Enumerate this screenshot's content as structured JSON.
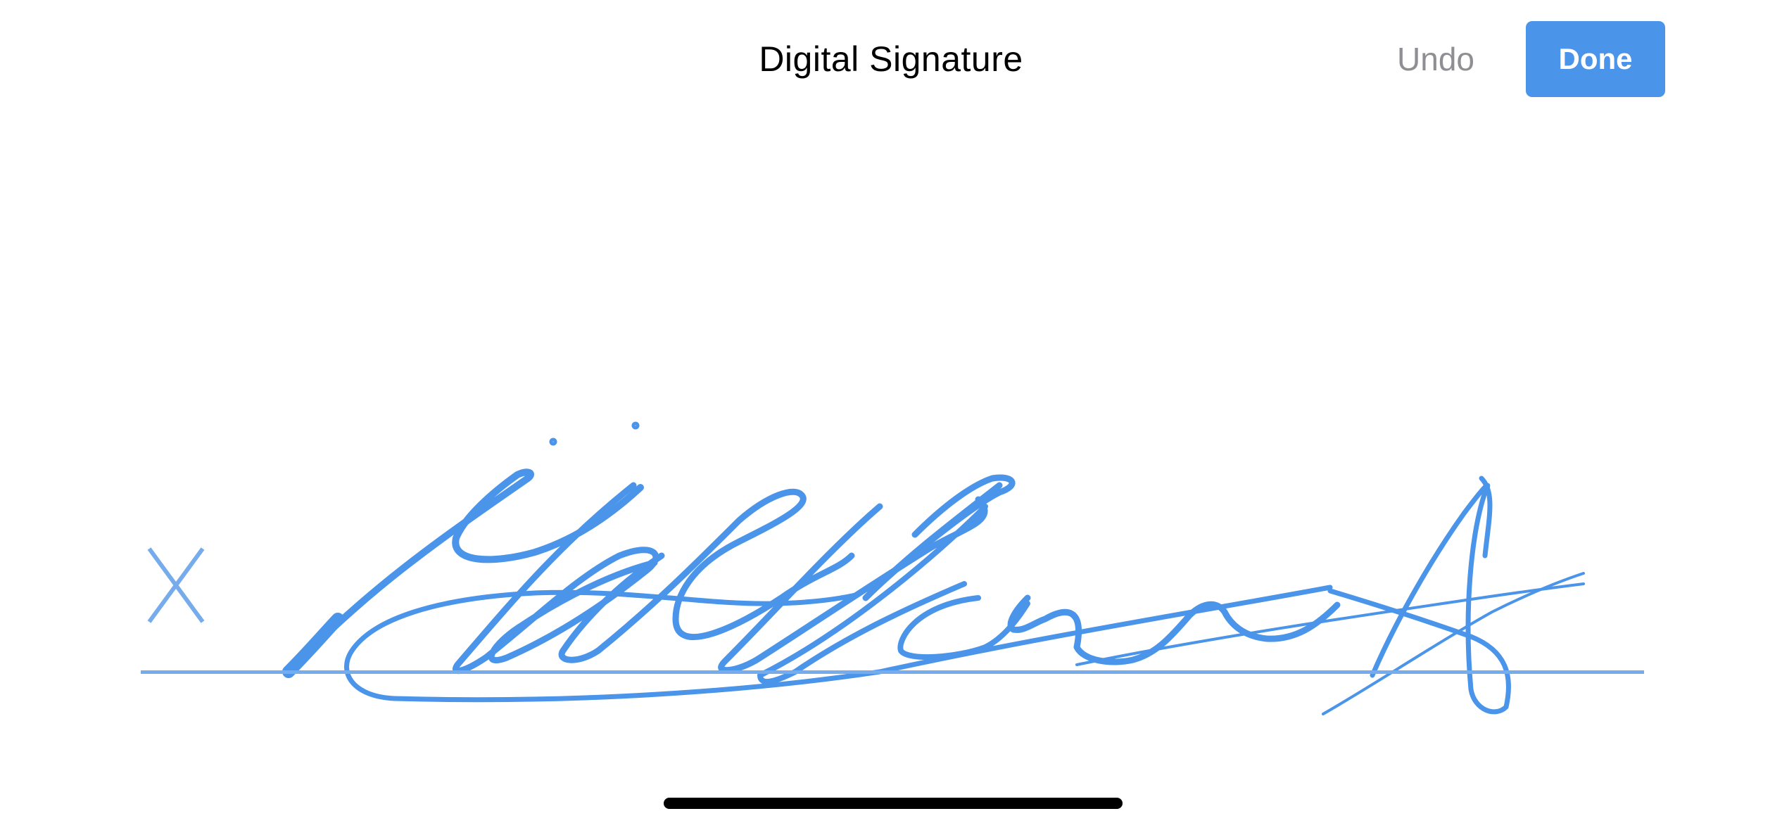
{
  "header": {
    "title": "Digital Signature",
    "undo_label": "Undo",
    "done_label": "Done"
  },
  "signature_pad": {
    "marker": "X",
    "has_signature": true
  },
  "colors": {
    "accent": "#4a94e9",
    "ink": "#4a94e9",
    "baseline": "#76aceb",
    "undo_text": "#8e8e93",
    "background": "#ffffff",
    "home_indicator": "#000000"
  },
  "icons": {
    "signature_marker": "x-icon"
  }
}
